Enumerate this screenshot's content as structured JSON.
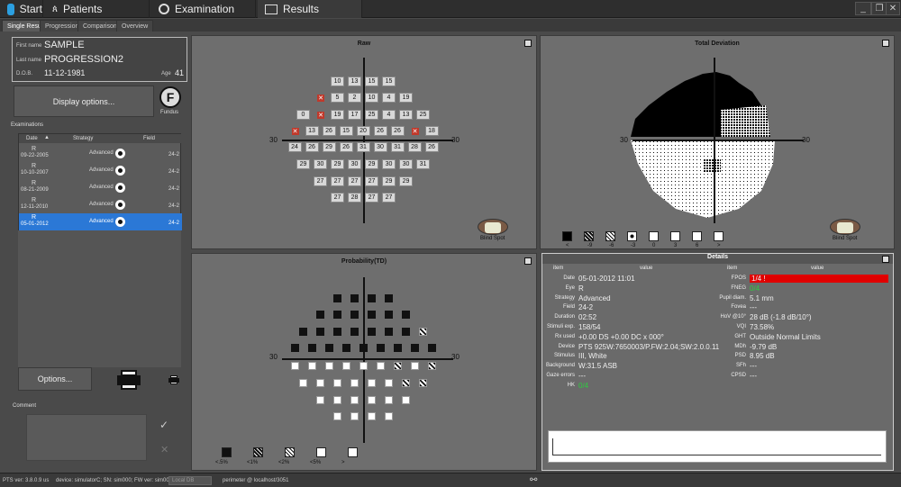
{
  "topbar": {
    "tabs": [
      {
        "label": "Start",
        "icon": "start-logo-icon"
      },
      {
        "label": "Patients",
        "icon": "patients-icon"
      },
      {
        "label": "Examination",
        "icon": "examination-icon"
      },
      {
        "label": "Results",
        "icon": "results-icon"
      }
    ]
  },
  "subtabs": [
    "Single Result",
    "Progression",
    "Comparison",
    "Overview"
  ],
  "patient": {
    "first_name_label": "First name",
    "first_name": "SAMPLE",
    "last_name_label": "Last name",
    "last_name": "PROGRESSION2",
    "dob_label": "D.O.B.",
    "dob": "11-12-1981",
    "age_label": "Age",
    "age": "41"
  },
  "display_options": "Display options...",
  "fundus_label": "Fundus",
  "examinations_label": "Examinations",
  "exam_table": {
    "headers": [
      "Date",
      "Strategy",
      "Field"
    ],
    "rows": [
      {
        "eye": "R",
        "date": "09-22-2005",
        "strategy": "Advanced",
        "field": "24-2"
      },
      {
        "eye": "R",
        "date": "10-10-2007",
        "strategy": "Advanced",
        "field": "24-2"
      },
      {
        "eye": "R",
        "date": "08-21-2009",
        "strategy": "Advanced",
        "field": "24-2"
      },
      {
        "eye": "R",
        "date": "12-11-2010",
        "strategy": "Advanced",
        "field": "24-2"
      },
      {
        "eye": "R",
        "date": "05-01-2012",
        "strategy": "Advanced",
        "field": "24-2",
        "selected": true
      }
    ]
  },
  "options_button": "Options...",
  "comment_label": "Comment",
  "panels": {
    "raw_title": "Raw",
    "td_title": "Total Deviation",
    "prob_title": "Probability(TD)",
    "axis_label": "30",
    "blind_spot": "Blind Spot"
  },
  "raw_values": [
    [
      "10",
      "13",
      "15",
      "15"
    ],
    [
      "x",
      "5",
      "2",
      "10",
      "4",
      "19"
    ],
    [
      "0",
      "x",
      "19",
      "17",
      "25",
      "4",
      "13",
      "25"
    ],
    [
      "x",
      "13",
      "26",
      "15",
      "20",
      "26",
      "26",
      "x",
      "18"
    ],
    [
      "24",
      "26",
      "29",
      "26",
      "31",
      "30",
      "31",
      "28",
      "26"
    ],
    [
      "29",
      "30",
      "29",
      "30",
      "29",
      "30",
      "30",
      "31"
    ],
    [
      "27",
      "27",
      "27",
      "27",
      "29",
      "29"
    ],
    [
      "27",
      "28",
      "27",
      "27"
    ]
  ],
  "td_legend": [
    "<",
    "-9",
    "-6",
    "-3",
    "0",
    "3",
    "6",
    ">"
  ],
  "prob_legend": [
    "<.5%",
    "<1%",
    "<2%",
    "<5%",
    ">"
  ],
  "details": {
    "title": "Details",
    "headers": [
      "item",
      "value",
      "item",
      "value"
    ],
    "left": [
      {
        "item": "Date",
        "value": "05-01-2012 11:01"
      },
      {
        "item": "Eye",
        "value": "R"
      },
      {
        "item": "Strategy",
        "value": "Advanced"
      },
      {
        "item": "Field",
        "value": "24-2"
      },
      {
        "item": "Duration",
        "value": "02:52"
      },
      {
        "item": "Stimuli exp.",
        "value": "158/54"
      },
      {
        "item": "Rx used",
        "value": "+0.00 DS +0.00 DC x 000°"
      },
      {
        "item": "Device",
        "value": "PTS 925W:7650003/P.FW:2.04;SW:2.0.0.11"
      },
      {
        "item": "Stimulus",
        "value": "III, White"
      },
      {
        "item": "Background",
        "value": "W:31.5 ASB"
      },
      {
        "item": "Gaze errors",
        "value": "---"
      },
      {
        "item": "HK",
        "value": "0/4"
      }
    ],
    "right": [
      {
        "item": "FPOS",
        "value": "1/4 !"
      },
      {
        "item": "FNEG",
        "value": "0/4"
      },
      {
        "item": "Pupil diam.",
        "value": "5.1 mm"
      },
      {
        "item": "Fovea",
        "value": "---"
      },
      {
        "item": "HoV @10°",
        "value": "28 dB (-1.8 dB/10°)"
      },
      {
        "item": "VQI",
        "value": "73.58%"
      },
      {
        "item": "GHT",
        "value": "Outside Normal Limits"
      },
      {
        "item": "MDh",
        "value": "-9.79 dB"
      },
      {
        "item": "PSD",
        "value": "8.95 dB"
      },
      {
        "item": "SFh",
        "value": "---"
      },
      {
        "item": "CPSD",
        "value": "---"
      }
    ]
  },
  "status": {
    "version": "PTS ver: 3.8.0.9 us",
    "device": "device: simulatorC; SN: sim000; FW ver: sim000",
    "local_db": "Local DB",
    "server": "perimeter @ localhost/3051"
  },
  "colors": {
    "accent": "#2b78d6",
    "warn": "#e00000",
    "ok": "#2ecc40"
  }
}
